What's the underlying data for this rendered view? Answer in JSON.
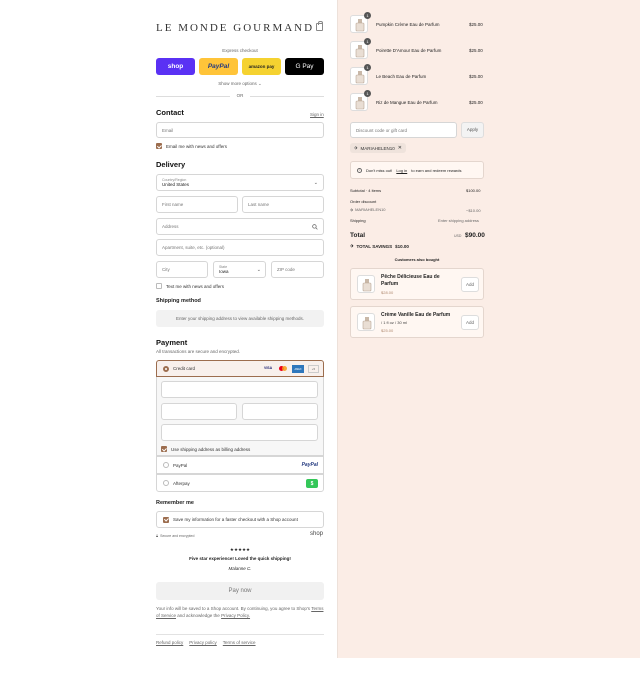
{
  "header": {
    "brand": "LE MONDE GOURMAND"
  },
  "express": {
    "title": "Express checkout",
    "shop": "shop",
    "paypal": "PayPal",
    "amazon": "amazon pay",
    "gpay": "G Pay",
    "show_more": "Show more options ⌄",
    "or": "OR"
  },
  "contact": {
    "title": "Contact",
    "sign_in": "Sign in",
    "email_placeholder": "Email",
    "newsletter_label": "Email me with news and offers"
  },
  "delivery": {
    "title": "Delivery",
    "country_label": "Country/Region",
    "country_value": "United States",
    "first_name": "First name",
    "last_name": "Last name",
    "address": "Address",
    "apartment": "Apartment, suite, etc. (optional)",
    "city": "City",
    "state_label": "State",
    "state_value": "Iowa",
    "zip": "ZIP code",
    "text_label": "Text me with news and offers"
  },
  "shipping_method": {
    "title": "Shipping method",
    "message": "Enter your shipping address to view available shipping methods."
  },
  "payment": {
    "title": "Payment",
    "subtitle": "All transactions are secure and encrypted.",
    "credit_card": "Credit card",
    "card_brands": [
      "VISA",
      "MC",
      "AMEX",
      "+5"
    ],
    "billing_label": "Use shipping address as billing address",
    "paypal": "PayPal",
    "paypal_logo": "PayPal",
    "afterpay": "Afterpay",
    "afterpay_logo": "$"
  },
  "remember": {
    "title": "Remember me",
    "save_label": "Save my information for a faster checkout with a Shop account",
    "secure": "Secure and encrypted",
    "shop_logo": "shop"
  },
  "review": {
    "stars": "★★★★★",
    "quote": "Five star experience! Loved the quick shipping!",
    "author": "Malanne C."
  },
  "pay_now": "Pay now",
  "legal": {
    "text1": "Your info will be saved to a Shop account. By continuing, you agree to Shop's",
    "terms": "Terms of Service",
    "text2": "and acknowledge the",
    "privacy": "Privacy Policy."
  },
  "footer": {
    "links": [
      "Refund policy",
      "Privacy policy",
      "Terms of service"
    ]
  },
  "cart": {
    "items": [
      {
        "name": "Pumpkin Crème Eau de Parfum",
        "qty": "1",
        "price": "$25.00"
      },
      {
        "name": "Poirette D'Amour Eau de Parfum",
        "qty": "1",
        "price": "$25.00"
      },
      {
        "name": "Le Beach Eau de Parfum",
        "qty": "1",
        "price": "$25.00"
      },
      {
        "name": "Riz de Mangue Eau de Parfum",
        "qty": "1",
        "price": "$25.00"
      }
    ]
  },
  "discount": {
    "placeholder": "Discount code or gift card",
    "apply": "Apply",
    "tag": "MARIAHELEN10"
  },
  "rewards": {
    "text_before": "Don't miss out!",
    "link": "Log in",
    "text_after": "to earn and redeem rewards"
  },
  "summary": {
    "subtotal_label": "Subtotal · 4 items",
    "subtotal_value": "$100.00",
    "order_discount_label": "Order discount",
    "discount_code": "MARIAHELEN10",
    "discount_value": "−$10.00",
    "shipping_label": "Shipping",
    "shipping_value": "Enter shipping address",
    "total_label": "Total",
    "currency": "USD",
    "total_value": "$90.00",
    "savings_label": "TOTAL SAVINGS",
    "savings_value": "$10.00"
  },
  "upsell": {
    "title": "Customers also bought",
    "items": [
      {
        "name1": "Pêche Délicieuse Eau de",
        "name2": "Parfum",
        "price": "$28.00",
        "button": "Add"
      },
      {
        "name1": "Crème Vanille Eau de Parfum",
        "name2": "/ 1 fl oz / 30 ml",
        "price": "$25.00",
        "button": "Add"
      }
    ]
  },
  "colors": {
    "accent": "#9c6d4e",
    "shop": "#5a31f4",
    "paypal": "#ffc439",
    "amazon": "#f5d230",
    "gpay": "#000000",
    "summary_bg": "#fbede6"
  }
}
